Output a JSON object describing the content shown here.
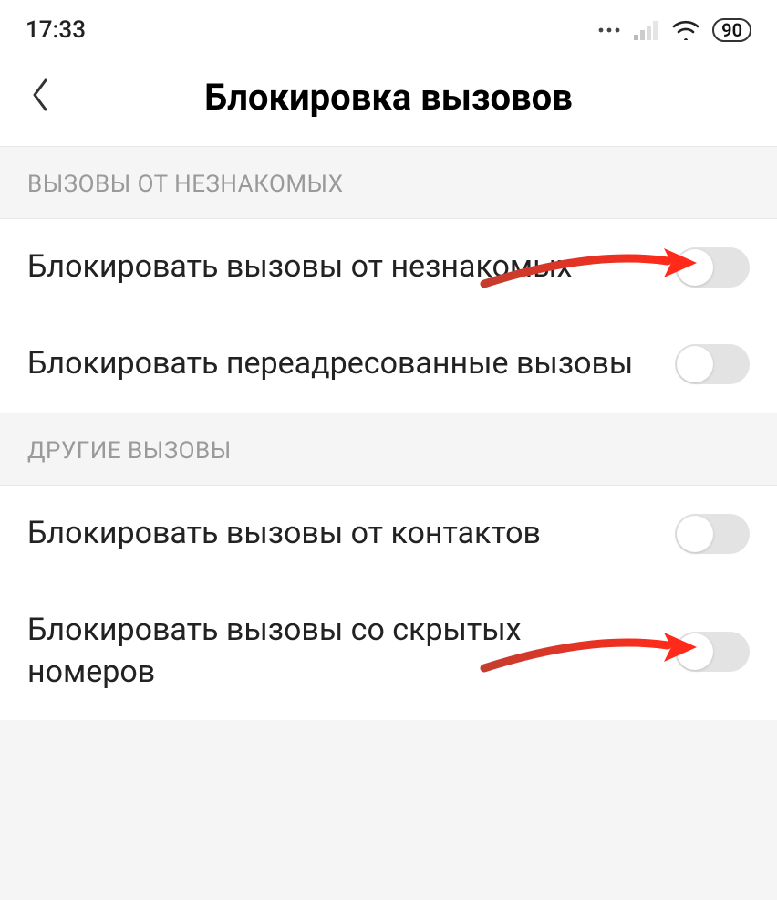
{
  "status": {
    "time": "17:33",
    "battery": "90"
  },
  "header": {
    "title": "Блокировка вызовов"
  },
  "sections": [
    {
      "header": "ВЫЗОВЫ ОТ НЕЗНАКОМЫХ",
      "items": [
        {
          "label": "Блокировать вызовы от незнакомых"
        },
        {
          "label": "Блокировать переадресованные вызовы"
        }
      ]
    },
    {
      "header": "ДРУГИЕ ВЫЗОВЫ",
      "items": [
        {
          "label": "Блокировать вызовы от контактов"
        },
        {
          "label": "Блокировать вызовы со скрытых номеров"
        }
      ]
    }
  ]
}
